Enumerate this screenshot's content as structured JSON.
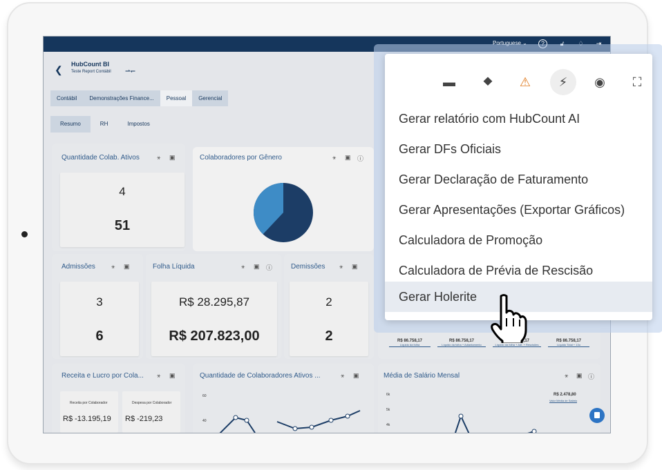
{
  "topbar": {
    "language": "Portuguese ⌄"
  },
  "header": {
    "title": "HubCount BI",
    "subtitle": "Teste Report Contábil"
  },
  "tabs": [
    "Contábil",
    "Demonstrações Finance...",
    "Pessoal",
    "Gerencial"
  ],
  "subtabs": [
    "Resumo",
    "RH",
    "Impostos"
  ],
  "panels": {
    "colab_ativos": {
      "title": "Quantidade Colab. Ativos",
      "a": "4",
      "b": "51"
    },
    "genero": {
      "title": "Colaboradores por Gênero",
      "slices": [
        62,
        38
      ]
    },
    "admissoes": {
      "title": "Admissões",
      "a": "3",
      "b": "6"
    },
    "folha": {
      "title": "Folha Líquida",
      "a": "R$ 28.295,87",
      "b": "R$ 207.823,00"
    },
    "demissoes": {
      "title": "Demissões",
      "a": "2",
      "b": "2"
    },
    "receita": {
      "title": "Receita e Lucro por Cola...",
      "c1_label": "Receita por Colaborador",
      "c1_value": "R$ -13.195,19",
      "c2_label": "Despesa por Colaborador",
      "c2_value": "R$ -219,23"
    },
    "qtd_colab": {
      "title": "Quantidade de Colaboradores Ativos ...",
      "y1": "60",
      "y2": "40"
    },
    "media": {
      "title": "Média de Salário Mensal",
      "y1": "6k",
      "y2": "5k",
      "y3": "4k",
      "value": "R$ 2.478,80",
      "value_label": "Valor Média de Salário"
    },
    "liquidos": [
      {
        "value": "R$ 86.758,17",
        "label": "Líquido da folha"
      },
      {
        "value": "R$ 86.758,17",
        "label": "Líquido da folha + Adiantamento"
      },
      {
        "value": "R$ 86.758,17",
        "label": "Líquido da folha + Adt. + Rescisões"
      },
      {
        "value": "R$ 86.758,17",
        "label": "Líquido Total + 13o"
      }
    ]
  },
  "popup": {
    "icons": [
      "folder-icon",
      "location-help-icon",
      "warning-icon",
      "bolt-icon",
      "eye-icon",
      "fullscreen-icon"
    ],
    "items": [
      "Gerar relatório com HubCount AI",
      "Gerar DFs Oficiais",
      "Gerar Declaração de Faturamento",
      "Gerar Apresentações (Exportar Gráficos)",
      "Calculadora de Promoção",
      "Calculadora de Prévia de Rescisão",
      "Gerar Holerite"
    ],
    "highlight_color": "#e7ebf1"
  }
}
